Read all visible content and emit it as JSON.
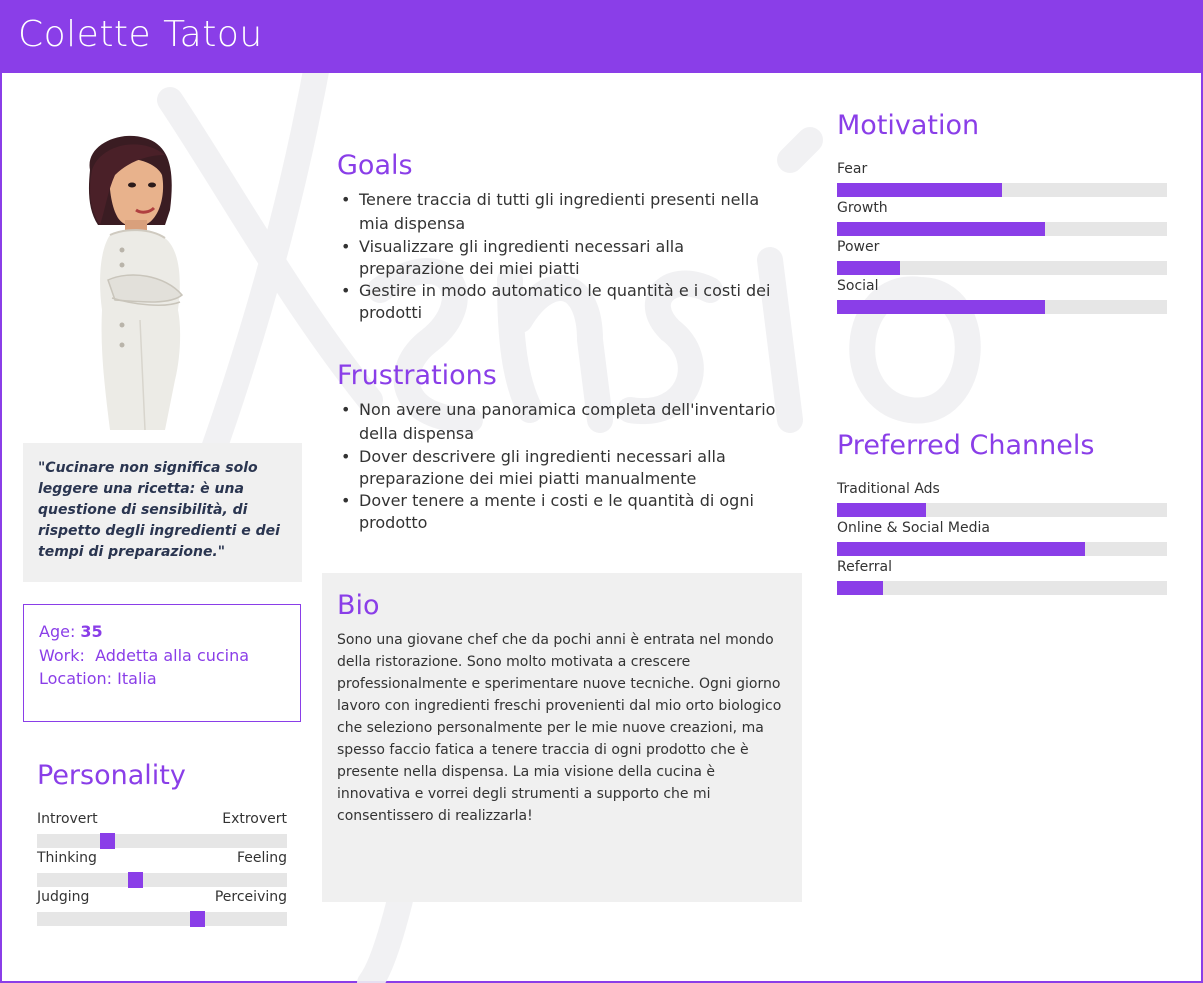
{
  "header": {
    "name": "Colette Tatou"
  },
  "quote": "\"Cucinare non significa solo leggere una ricetta: è una questione di sensibilità, di rispetto degli ingredienti e dei tempi di preparazione.\"",
  "info": {
    "age_label": "Age: ",
    "age_value": "35",
    "work_label": "Work: ",
    "work_value": "Addetta alla cucina",
    "location_label": "Location: ",
    "location_value": "Italia"
  },
  "personality": {
    "title": "Personality",
    "sliders": [
      {
        "left": "Introvert",
        "right": "Extrovert",
        "value": 0.28
      },
      {
        "left": "Thinking",
        "right": "Feeling",
        "value": 0.39
      },
      {
        "left": "Judging",
        "right": "Perceiving",
        "value": 0.64
      }
    ]
  },
  "goals": {
    "title": "Goals",
    "items": [
      "Tenere traccia di tutti gli ingredienti presenti nella mia dispensa",
      "Visualizzare gli ingredienti necessari alla preparazione dei miei piatti",
      "Gestire in modo automatico le quantità e i costi dei prodotti"
    ]
  },
  "frustrations": {
    "title": "Frustrations",
    "items": [
      "Non avere una panoramica completa dell'inventario della dispensa",
      "Dover descrivere gli ingredienti necessari alla preparazione dei miei piatti manualmente",
      "Dover tenere a mente i costi e le quantità di ogni prodotto"
    ]
  },
  "bio": {
    "title": "Bio",
    "text": "Sono una giovane chef che da pochi anni è entrata nel mondo della ristorazione. Sono molto motivata a crescere professionalmente e sperimentare nuove tecniche. Ogni giorno lavoro con ingredienti freschi provenienti dal mio orto biologico che seleziono personalmente per le mie nuove creazioni, ma spesso faccio fatica a tenere traccia di ogni prodotto che è presente nella dispensa. La mia visione della cucina è innovativa e vorrei degli strumenti a supporto che mi consentissero di realizzarla!"
  },
  "motivation": {
    "title": "Motivation",
    "bars": [
      {
        "label": "Fear",
        "value": 0.5
      },
      {
        "label": "Growth",
        "value": 0.63
      },
      {
        "label": "Power",
        "value": 0.19
      },
      {
        "label": "Social",
        "value": 0.63
      }
    ]
  },
  "channels": {
    "title": "Preferred Channels",
    "bars": [
      {
        "label": "Traditional Ads",
        "value": 0.27
      },
      {
        "label": "Online & Social Media",
        "value": 0.75
      },
      {
        "label": "Referral",
        "value": 0.14
      }
    ]
  },
  "colors": {
    "accent": "#8a3ee8",
    "panel": "#f0f0f0",
    "track": "#e6e6e6"
  }
}
